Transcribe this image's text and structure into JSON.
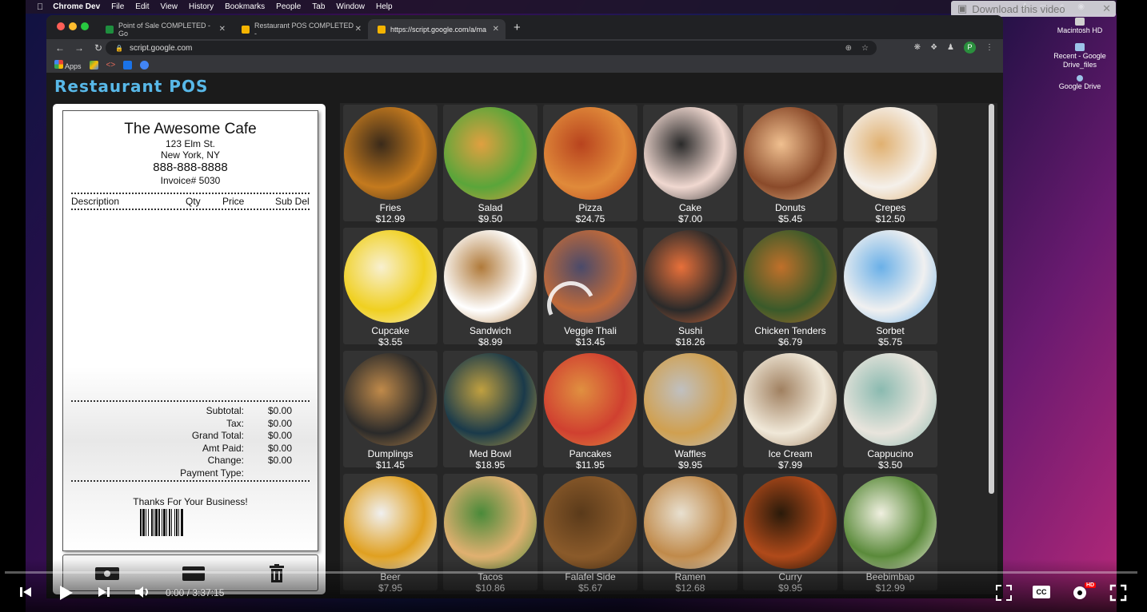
{
  "mac_menubar": {
    "app_name": "Chrome Dev",
    "items": [
      "File",
      "Edit",
      "View",
      "History",
      "Bookmarks",
      "People",
      "Tab",
      "Window",
      "Help"
    ]
  },
  "download_button": {
    "label": "Download this video"
  },
  "desktop_icons": [
    {
      "label": "Macintosh HD",
      "icon": "disk-icon"
    },
    {
      "label": "Recent - Google Drive_files",
      "icon": "folder-icon"
    },
    {
      "label": "Google Drive",
      "icon": "google-drive-icon"
    }
  ],
  "browser": {
    "tabs": [
      {
        "title": "Point of Sale COMPLETED - Go",
        "icon": "sheets-icon",
        "color": "#1e8e3e",
        "active": false
      },
      {
        "title": "Restaurant POS COMPLETED -",
        "icon": "apps-script-icon",
        "color": "#f4b400",
        "active": false
      },
      {
        "title": "https://script.google.com/a/ma",
        "icon": "apps-script-icon",
        "color": "#f4b400",
        "active": true
      }
    ],
    "address": "script.google.com",
    "profile_initial": "P",
    "bookmarks": [
      {
        "label": "Apps",
        "icon": "apps-grid-icon"
      },
      {
        "label": "",
        "icon": "drive-icon"
      },
      {
        "label": "",
        "icon": "code-icon"
      },
      {
        "label": "",
        "icon": "flag-icon"
      },
      {
        "label": "",
        "icon": "f-icon"
      }
    ]
  },
  "app": {
    "title": "Restaurant POS",
    "accent": "#58b8e8"
  },
  "receipt": {
    "cafe_name": "The Awesome Cafe",
    "address1": "123 Elm St.",
    "address2": "New York, NY",
    "phone": "888-888-8888",
    "invoice": "Invoice# 5030",
    "columns": {
      "description": "Description",
      "qty": "Qty",
      "price": "Price",
      "sub": "Sub Del"
    },
    "totals": [
      {
        "label": "Subtotal:",
        "value": "$0.00"
      },
      {
        "label": "Tax:",
        "value": "$0.00"
      },
      {
        "label": "Grand Total:",
        "value": "$0.00"
      },
      {
        "label": "Amt Paid:",
        "value": "$0.00"
      },
      {
        "label": "Change:",
        "value": "$0.00"
      },
      {
        "label": "Payment Type:",
        "value": ""
      }
    ],
    "thanks": "Thanks For Your Business!"
  },
  "actions": [
    {
      "name": "cash-button",
      "icon": "cash-icon"
    },
    {
      "name": "card-button",
      "icon": "credit-card-icon"
    },
    {
      "name": "delete-button",
      "icon": "trash-icon"
    }
  ],
  "menu_items": [
    {
      "name": "Fries",
      "price": "$12.99",
      "colors": [
        "#c47a1e",
        "#3a2a1a"
      ]
    },
    {
      "name": "Salad",
      "price": "$9.50",
      "colors": [
        "#5aa53a",
        "#e0a040"
      ]
    },
    {
      "name": "Pizza",
      "price": "$24.75",
      "colors": [
        "#e08a3a",
        "#b8431e"
      ]
    },
    {
      "name": "Cake",
      "price": "$7.00",
      "colors": [
        "#f0d8d0",
        "#2a2a2a"
      ]
    },
    {
      "name": "Donuts",
      "price": "$5.45",
      "colors": [
        "#8a4a2a",
        "#f0c090"
      ]
    },
    {
      "name": "Crepes",
      "price": "$12.50",
      "colors": [
        "#f5f0ea",
        "#e0b070"
      ]
    },
    {
      "name": "Cupcake",
      "price": "$3.55",
      "colors": [
        "#f0d020",
        "#f8f0d0"
      ]
    },
    {
      "name": "Sandwich",
      "price": "$8.99",
      "colors": [
        "#ffffff",
        "#b07a3a"
      ]
    },
    {
      "name": "Veggie Thali",
      "price": "$13.45",
      "colors": [
        "#c06a3a",
        "#4a4a6a"
      ]
    },
    {
      "name": "Sushi",
      "price": "$18.26",
      "colors": [
        "#2a2a2a",
        "#e8703a"
      ]
    },
    {
      "name": "Chicken Tenders",
      "price": "$6.79",
      "colors": [
        "#3a5a2a",
        "#c0702a"
      ]
    },
    {
      "name": "Sorbet",
      "price": "$5.75",
      "colors": [
        "#f0f0f0",
        "#6ab0e8"
      ]
    },
    {
      "name": "Dumplings",
      "price": "$11.45",
      "colors": [
        "#2a2a2a",
        "#c08a4a"
      ]
    },
    {
      "name": "Med Bowl",
      "price": "$18.95",
      "colors": [
        "#1a3a4a",
        "#c0a040"
      ]
    },
    {
      "name": "Pancakes",
      "price": "$11.95",
      "colors": [
        "#d04030",
        "#e09040"
      ]
    },
    {
      "name": "Waffles",
      "price": "$9.95",
      "colors": [
        "#d0a050",
        "#c0c0c0"
      ]
    },
    {
      "name": "Ice Cream",
      "price": "$7.99",
      "colors": [
        "#f0e8d8",
        "#a08060"
      ]
    },
    {
      "name": "Cappucino",
      "price": "$3.50",
      "colors": [
        "#e8e4dc",
        "#8abab0"
      ]
    },
    {
      "name": "Beer",
      "price": "$7.95",
      "colors": [
        "#e0a020",
        "#f0f0f0"
      ]
    },
    {
      "name": "Tacos",
      "price": "$10.86",
      "colors": [
        "#e0b070",
        "#4a8a3a"
      ]
    },
    {
      "name": "Falafel Side",
      "price": "$5.67",
      "colors": [
        "#8a5a2a",
        "#5a3a1a"
      ]
    },
    {
      "name": "Ramen",
      "price": "$12.68",
      "colors": [
        "#c08a4a",
        "#e8e0d0"
      ]
    },
    {
      "name": "Curry",
      "price": "$9.95",
      "colors": [
        "#b04a1a",
        "#2a1a0a"
      ]
    },
    {
      "name": "Beebimbap",
      "price": "$12.99",
      "colors": [
        "#5a8a3a",
        "#f0f0e0"
      ]
    }
  ],
  "player": {
    "time": "0:00 / 3:37:15",
    "progress": 0,
    "icons": [
      "prev-icon",
      "play-icon",
      "next-icon",
      "volume-icon",
      "miniplayer-icon",
      "captions-icon",
      "settings-icon",
      "fullscreen-icon"
    ],
    "hd_badge": "HD",
    "cc_label": "CC"
  }
}
